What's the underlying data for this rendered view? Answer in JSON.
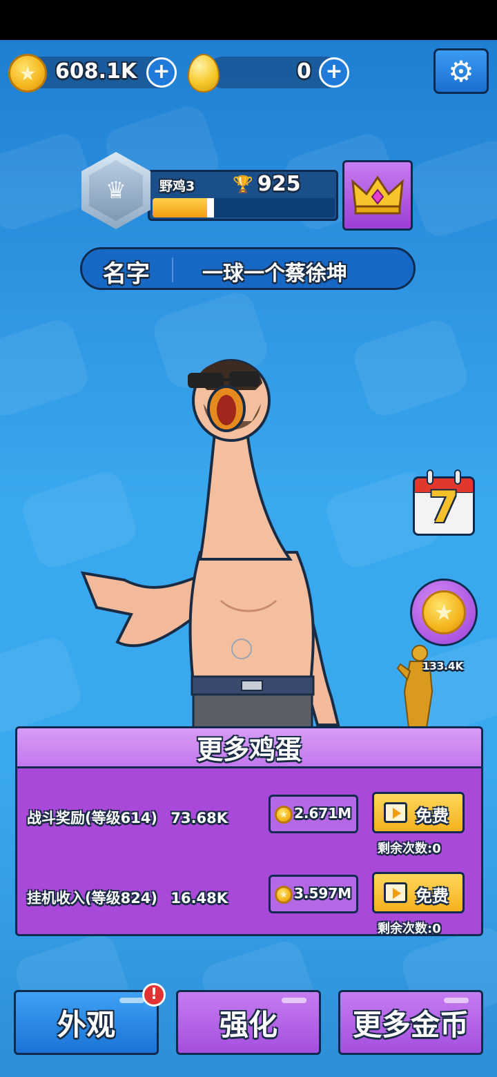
{
  "currencies": {
    "gold_value": "608.1K",
    "egg_value": "0"
  },
  "rank": {
    "tier_name": "野鸡3",
    "trophies": "925",
    "progress_fraction": 0.3
  },
  "player": {
    "name_label": "名字",
    "name_value": "一球一个蔡徐坤"
  },
  "side_buttons": {
    "calendar_day": "7",
    "coin_bubble_value": "133.4K"
  },
  "more_eggs_panel": {
    "title": "更多鸡蛋",
    "rows": [
      {
        "label": "战斗奖励(等级614)",
        "value": "73.68K",
        "cost": "2.671M",
        "free_label": "免费",
        "remaining": "剩余次数:0"
      },
      {
        "label": "挂机收入(等级824)",
        "value": "16.48K",
        "cost": "3.597M",
        "free_label": "免费",
        "remaining": "剩余次数:0"
      }
    ]
  },
  "bottom_nav": {
    "appearance": "外观",
    "upgrade": "强化",
    "more_coins": "更多金币",
    "alert_mark": "!"
  },
  "icons": {
    "gold": "gold-coin-icon",
    "egg": "golden-egg-icon",
    "settings": "gear-icon",
    "trophy": "trophy-icon",
    "crown": "crown-icon",
    "calendar": "calendar-icon",
    "video": "video-ad-icon"
  },
  "colors": {
    "background": "#3aa8ef",
    "panel_purple": "#a849d9",
    "button_yellow": "#f4b11f",
    "outline": "#0e2b4f"
  }
}
